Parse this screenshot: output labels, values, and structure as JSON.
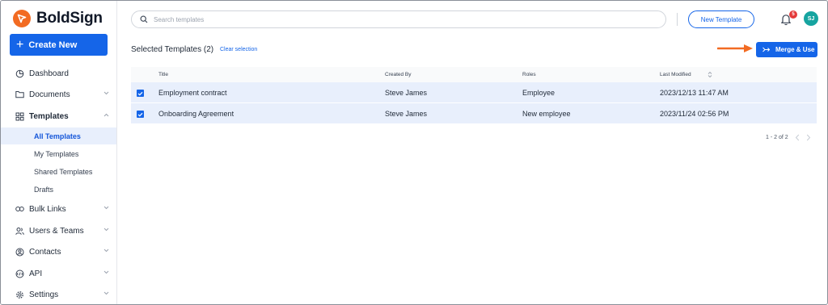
{
  "app": {
    "brand_name": "BoldSign",
    "brand_color": "#f26b22",
    "accent_color": "#1565e8"
  },
  "sidebar": {
    "create_label": "Create New",
    "items": [
      {
        "label": "Dashboard",
        "icon": "dashboard-icon"
      },
      {
        "label": "Documents",
        "icon": "folder-icon"
      },
      {
        "label": "Templates",
        "icon": "grid-icon"
      },
      {
        "label": "Bulk Links",
        "icon": "link-icon"
      },
      {
        "label": "Users & Teams",
        "icon": "users-icon"
      },
      {
        "label": "Contacts",
        "icon": "contacts-icon"
      },
      {
        "label": "API",
        "icon": "api-icon"
      },
      {
        "label": "Settings",
        "icon": "gear-icon"
      }
    ],
    "template_subitems": [
      "All Templates",
      "My Templates",
      "Shared Templates",
      "Drafts"
    ]
  },
  "header": {
    "search_placeholder": "Search templates",
    "new_template_label": "New Template",
    "notification_count": "5",
    "avatar_initials": "SJ"
  },
  "selection": {
    "title": "Selected Templates (2)",
    "clear_label": "Clear selection",
    "merge_label": "Merge & Use"
  },
  "table": {
    "columns": [
      "Title",
      "Created By",
      "Roles",
      "Last Modified"
    ],
    "rows": [
      {
        "title": "Employment contract",
        "created_by": "Steve James",
        "roles": "Employee",
        "last_modified": "2023/12/13 11:47 AM"
      },
      {
        "title": "Onboarding Agreement",
        "created_by": "Steve James",
        "roles": "New employee",
        "last_modified": "2023/11/24 02:56 PM"
      }
    ]
  },
  "pagination": {
    "label": "1 - 2 of 2"
  }
}
